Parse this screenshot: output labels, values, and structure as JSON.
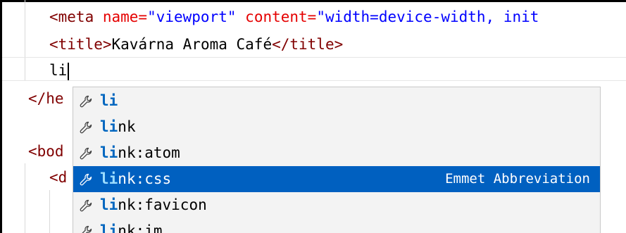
{
  "editor": {
    "lines": [
      {
        "parts": [
          {
            "t": "<meta ",
            "c": "tag"
          },
          {
            "t": "name=",
            "c": "attr"
          },
          {
            "t": "\"viewport\"",
            "c": "str"
          },
          {
            "t": " ",
            "c": "txt"
          },
          {
            "t": "content=",
            "c": "attr"
          },
          {
            "t": "\"width=device-width, init",
            "c": "str"
          }
        ]
      },
      {
        "parts": [
          {
            "t": "<title>",
            "c": "tag"
          },
          {
            "t": "Kavárna Aroma Café",
            "c": "txt"
          },
          {
            "t": "</title>",
            "c": "tag"
          }
        ]
      },
      {
        "parts": [
          {
            "t": "li",
            "c": "txt"
          }
        ]
      },
      {
        "parts": [
          {
            "t": "</he",
            "c": "tag"
          }
        ]
      },
      {
        "parts": [
          {
            "t": "<bod",
            "c": "tag"
          }
        ]
      },
      {
        "parts": [
          {
            "t": "<d",
            "c": "tag"
          }
        ]
      }
    ]
  },
  "suggest": {
    "items": [
      {
        "match": "li",
        "rest": "",
        "detail": ""
      },
      {
        "match": "li",
        "rest": "nk",
        "detail": ""
      },
      {
        "match": "li",
        "rest": "nk:atom",
        "detail": ""
      },
      {
        "match": "li",
        "rest": "nk:css",
        "detail": "Emmet Abbreviation"
      },
      {
        "match": "li",
        "rest": "nk:favicon",
        "detail": ""
      },
      {
        "match": "li",
        "rest": "nk:im",
        "detail": ""
      }
    ],
    "selected_index": 3,
    "icon": "wrench-icon"
  }
}
